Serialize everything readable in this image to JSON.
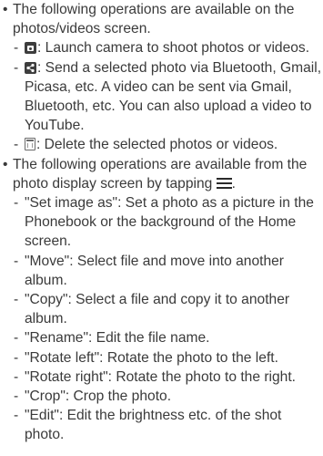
{
  "section1": {
    "intro": "The following operations are available on the photos/videos screen.",
    "items": [
      {
        "icon": "camera-icon",
        "text": ": Launch camera to shoot photos or videos."
      },
      {
        "icon": "share-icon",
        "text": ": Send a selected photo via Bluetooth, Gmail, Picasa, etc. A video can be sent via Gmail, Bluetooth, etc. You can also upload a video to YouTube."
      },
      {
        "icon": "trash-icon",
        "text": ": Delete the selected photos or videos."
      }
    ]
  },
  "section2": {
    "intro": "The following operations are available from the photo display screen by tapping",
    "intro_end": ".",
    "menu_icon": "menu-icon",
    "items": [
      "\"Set image as\": Set a photo as a picture in the Phonebook or the background of the Home screen.",
      "\"Move\": Select file and move into another album.",
      "\"Copy\": Select a file and copy it to another album.",
      "\"Rename\": Edit the file name.",
      "\"Rotate left\": Rotate the photo to the left.",
      "\"Rotate right\": Rotate the photo to the right.",
      "\"Crop\": Crop the photo.",
      "\"Edit\": Edit the brightness etc. of the shot photo."
    ]
  }
}
